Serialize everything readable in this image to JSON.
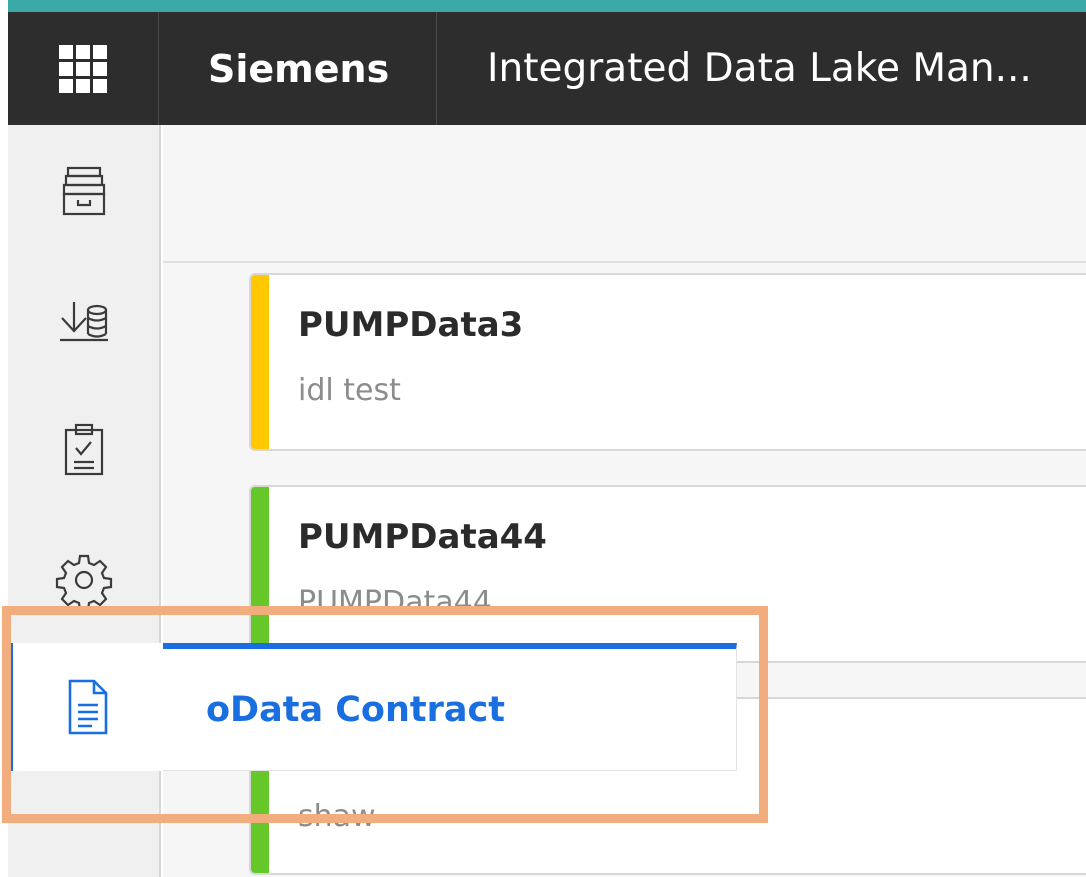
{
  "header": {
    "brand": "Siemens",
    "app_title": "Integrated Data Lake Man...",
    "apps_icon": "apps-grid-icon"
  },
  "sidebar": {
    "items": [
      {
        "icon": "archive-drawer-icon"
      },
      {
        "icon": "data-import-icon"
      },
      {
        "icon": "clipboard-check-icon"
      },
      {
        "icon": "gear-icon"
      },
      {
        "icon": "document-icon",
        "active": true
      }
    ]
  },
  "cards": [
    {
      "title": "PUMPData3",
      "subtitle": "idl test",
      "status_color": "#ffc800"
    },
    {
      "title": "PUMPData44",
      "subtitle": "PUMPData44",
      "status_color": "#65c728"
    },
    {
      "title": "",
      "subtitle": "shaw",
      "status_color": "#65c728"
    }
  ],
  "popup": {
    "label": "oData Contract"
  },
  "colors": {
    "accent": "#1a6fe0",
    "topbar": "#2d2d2d",
    "teal_strip": "#3aa9a8",
    "highlight": "#f2ad7f"
  }
}
